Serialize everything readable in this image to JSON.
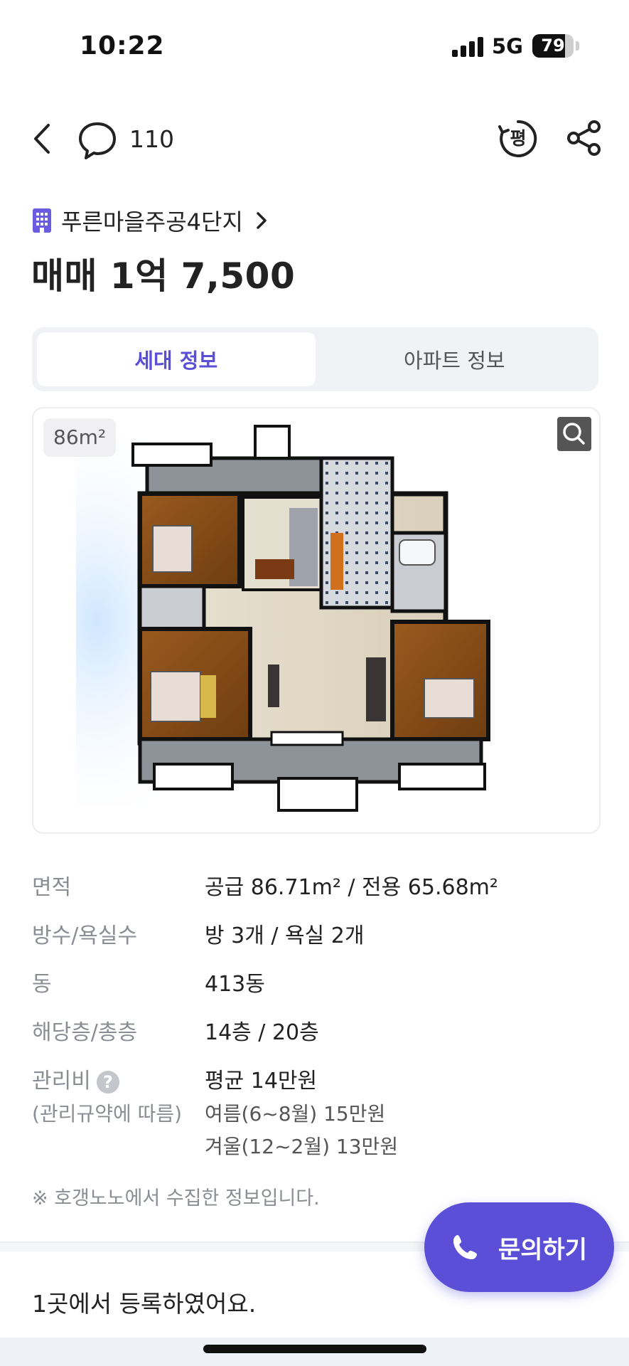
{
  "status_bar": {
    "time": "10:22",
    "network": "5G",
    "battery": "79",
    "battery_level": 79
  },
  "header": {
    "comment_count": "110",
    "pyeong_label": "평"
  },
  "listing": {
    "complex_name": "푸른마을주공4단지",
    "price": "매매 1억 7,500"
  },
  "tabs": [
    {
      "label": "세대 정보",
      "active": true
    },
    {
      "label": "아파트 정보",
      "active": false
    }
  ],
  "plan": {
    "area_badge": "86m²"
  },
  "info": {
    "area": {
      "label": "면적",
      "value": "공급 86.71m² / 전용 65.68m²"
    },
    "rooms": {
      "label": "방수/욕실수",
      "value": "방 3개 / 욕실 2개"
    },
    "building": {
      "label": "동",
      "value": "413동"
    },
    "floor": {
      "label": "해당층/총층",
      "value": "14층 / 20층"
    },
    "fee": {
      "label": "관리비",
      "sublabel": "(관리규약에 따름)",
      "value": "평균 14만원",
      "summer": "여름(6~8월) 15만원",
      "winter": "겨울(12~2월) 13만원"
    }
  },
  "note": "※ 호갱노노에서 수집한 정보입니다.",
  "registered": "1곳에서 등록하였어요.",
  "inquire_button": "문의하기",
  "colors": {
    "accent": "#5a4fd6",
    "muted": "#8a8d93"
  }
}
